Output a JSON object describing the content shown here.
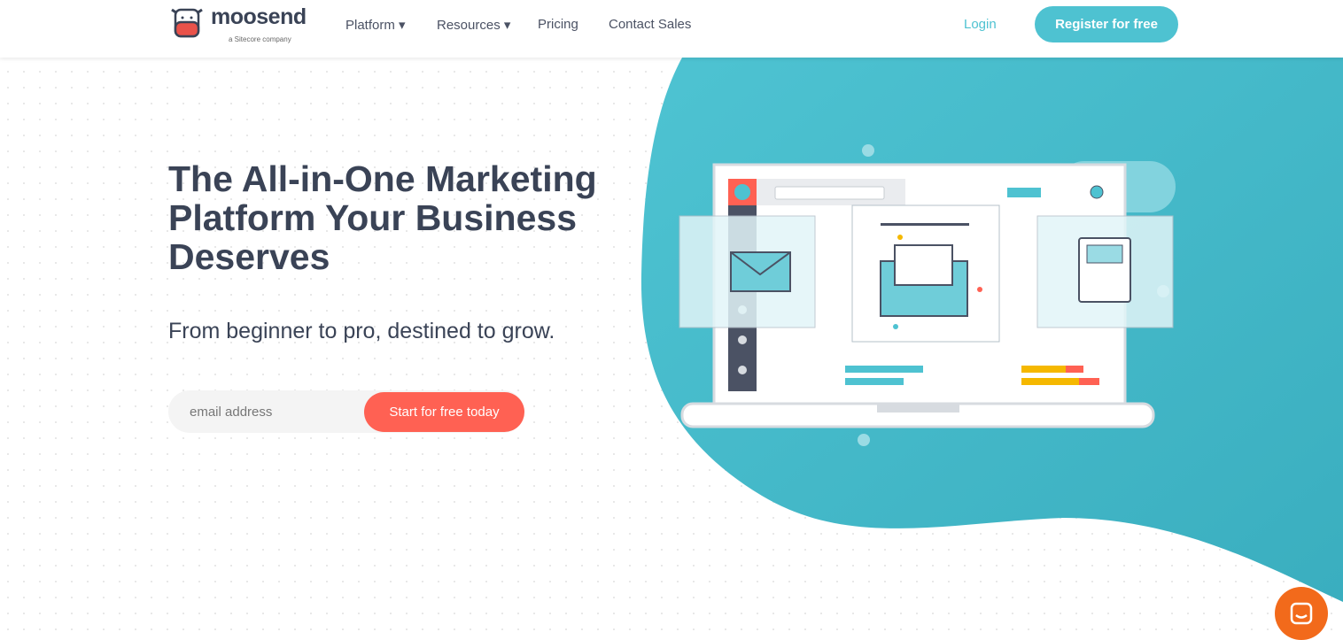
{
  "header": {
    "logo_text": "moosend",
    "logo_sub": "a Sitecore company",
    "nav": [
      {
        "label": "Platform ▾"
      },
      {
        "label": "Resources ▾"
      },
      {
        "label": "Pricing"
      },
      {
        "label": "Contact Sales"
      }
    ],
    "login": "Login",
    "register": "Register for free"
  },
  "hero": {
    "title": "The All-in-One Marketing Platform Your Business Deserves",
    "subtitle": "From beginner to pro, destined to grow.",
    "email_placeholder": "email address",
    "cta": "Start for free today"
  },
  "colors": {
    "brand": "#4ec2d1",
    "cta": "#ff6153",
    "text": "#3a4356",
    "chat": "#f26a1b"
  },
  "icons": [
    "moosend-cow-logo",
    "laptop-illustration",
    "chat-icon"
  ]
}
